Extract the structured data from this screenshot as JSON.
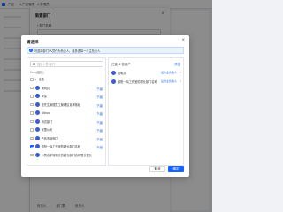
{
  "topbar": {
    "tabs": [
      "产品",
      "A 产品管理",
      "A 管理员"
    ]
  },
  "drawer": {
    "title": "新建部门",
    "label": "* 部门名称",
    "footer": [
      "负责人",
      "部门群",
      "负责人"
    ]
  },
  "modal": {
    "title": "请选择",
    "notice": "可选择部门/人员作为负责人，最多选择一个主负责人",
    "search_placeholder": "搜索人员/部门",
    "org_label": "Cnbr(组织)",
    "tree": [
      {
        "name": "全选",
        "checked": false,
        "sub": ""
      },
      {
        "name": "张明亮",
        "checked": false,
        "sub": "下级"
      },
      {
        "name": "李雪",
        "checked": false,
        "sub": "下级"
      },
      {
        "name": "首先生管理员工管理信息审核组",
        "checked": false,
        "sub": "下级"
      },
      {
        "name": "Shinoo",
        "checked": false,
        "sub": "下级"
      },
      {
        "name": "测试部门",
        "checked": false,
        "sub": "下级"
      },
      {
        "name": "有限公司",
        "checked": false,
        "sub": "下级"
      },
      {
        "name": "产品市场部门",
        "checked": false,
        "sub": "下级"
      },
      {
        "name": "欧阳一鸣工作室的超长部门名称",
        "checked": true,
        "sub": "下级"
      },
      {
        "name": "人员名字特别长的超长部门名称很长很长",
        "checked": false,
        "sub": ""
      }
    ],
    "right": {
      "header": "已选: 2 名用户",
      "clear": "清空",
      "selected": [
        {
          "name": "张明亮",
          "role": "设为主负责人"
        },
        {
          "name": "欧阳一鸣工作室的超长部门名称",
          "role": "设为主负责人"
        }
      ]
    },
    "cancel": "取消",
    "ok": "确定"
  }
}
